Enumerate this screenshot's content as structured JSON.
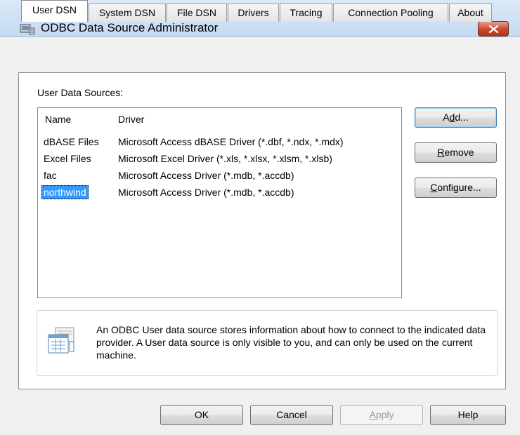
{
  "window": {
    "title": "ODBC Data Source Administrator"
  },
  "tabs": [
    {
      "label": "User DSN",
      "active": true
    },
    {
      "label": "System DSN",
      "active": false
    },
    {
      "label": "File DSN",
      "active": false
    },
    {
      "label": "Drivers",
      "active": false
    },
    {
      "label": "Tracing",
      "active": false
    },
    {
      "label": "Connection Pooling",
      "active": false
    },
    {
      "label": "About",
      "active": false
    }
  ],
  "user_dsn": {
    "section_label": "User Data Sources:",
    "columns": {
      "name": "Name",
      "driver": "Driver"
    },
    "rows": [
      {
        "name": "dBASE Files",
        "driver": "Microsoft Access dBASE Driver (*.dbf, *.ndx, *.mdx)",
        "selected": false
      },
      {
        "name": "Excel Files",
        "driver": "Microsoft Excel Driver (*.xls, *.xlsx, *.xlsm, *.xlsb)",
        "selected": false
      },
      {
        "name": "fac",
        "driver": "Microsoft Access Driver (*.mdb, *.accdb)",
        "selected": false
      },
      {
        "name": "northwind",
        "driver": "Microsoft Access Driver (*.mdb, *.accdb)",
        "selected": true
      }
    ],
    "buttons": {
      "add": {
        "pre": "A",
        "ul": "d",
        "post": "d..."
      },
      "remove": {
        "pre": "",
        "ul": "R",
        "post": "emove"
      },
      "configure": {
        "pre": "",
        "ul": "C",
        "post": "onfigure..."
      }
    },
    "info_text": "An ODBC User data source stores information about how to connect to the indicated data provider.   A User data source is only visible to you, and can only be used on the current machine."
  },
  "footer": {
    "ok": "OK",
    "cancel": "Cancel",
    "apply": {
      "pre": "",
      "ul": "A",
      "post": "pply"
    },
    "help": "Help"
  },
  "colors": {
    "selection": "#3399ff",
    "close_button": "#c9462c"
  }
}
